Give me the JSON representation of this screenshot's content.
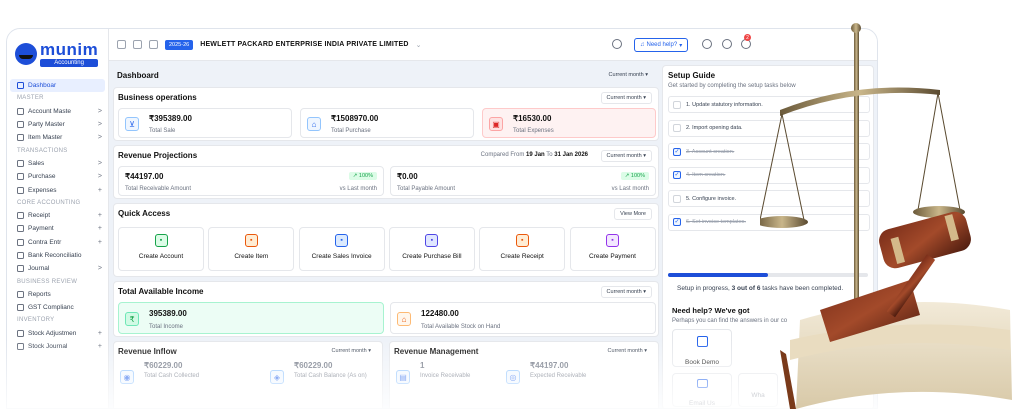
{
  "app": {
    "brand": "munim",
    "brand_sub": "Accounting",
    "fy": "2025-26",
    "company": "HEWLETT PACKARD ENTERPRISE INDIA PRIVATE LIMITED",
    "help": "Need help?",
    "notif_count": "2"
  },
  "sidebar": {
    "items": [
      {
        "type": "item",
        "label": "Dashboar",
        "active": true,
        "icon": "home-icon"
      },
      {
        "type": "sec",
        "label": "MASTER"
      },
      {
        "type": "item",
        "label": "Account Maste",
        "ar": ">",
        "icon": "bank-icon"
      },
      {
        "type": "item",
        "label": "Party Master",
        "ar": ">",
        "icon": "user-icon"
      },
      {
        "type": "item",
        "label": "Item Master",
        "ar": ">",
        "icon": "box-icon"
      },
      {
        "type": "sec",
        "label": "TRANSACTIONS"
      },
      {
        "type": "item",
        "label": "Sales",
        "ar": ">",
        "icon": "cart-icon"
      },
      {
        "type": "item",
        "label": "Purchase",
        "ar": ">",
        "icon": "bag-icon"
      },
      {
        "type": "item",
        "label": "Expenses",
        "ar": "+",
        "icon": "expense-icon"
      },
      {
        "type": "sec",
        "label": "CORE ACCOUNTING"
      },
      {
        "type": "item",
        "label": "Receipt",
        "ar": "+",
        "icon": "receipt-icon"
      },
      {
        "type": "item",
        "label": "Payment",
        "ar": "+",
        "icon": "payment-icon"
      },
      {
        "type": "item",
        "label": "Contra Entr",
        "ar": "+",
        "icon": "contra-icon"
      },
      {
        "type": "item",
        "label": "Bank Reconciliatio",
        "ar": "",
        "icon": "bank-rec-icon"
      },
      {
        "type": "item",
        "label": "Journal",
        "ar": ">",
        "icon": "journal-icon"
      },
      {
        "type": "sec",
        "label": "BUSINESS REVIEW"
      },
      {
        "type": "item",
        "label": "Reports",
        "ar": "",
        "icon": "report-icon"
      },
      {
        "type": "item",
        "label": "GST Complianc",
        "ar": "",
        "icon": "gst-icon"
      },
      {
        "type": "sec",
        "label": "INVENTORY"
      },
      {
        "type": "item",
        "label": "Stock Adjustmen",
        "ar": "+",
        "icon": "stock-icon"
      },
      {
        "type": "item",
        "label": "Stock Journal",
        "ar": "+",
        "icon": "stock-journal-icon"
      }
    ]
  },
  "dashboard": {
    "title": "Dashboard",
    "period": "Current month"
  },
  "business_ops": {
    "title": "Business operations",
    "period": "Current month",
    "cards": [
      {
        "value": "₹395389.00",
        "label": "Total Sale",
        "color": "#2563eb"
      },
      {
        "value": "₹1508970.00",
        "label": "Total Purchase",
        "color": "#2563eb"
      },
      {
        "value": "₹16530.00",
        "label": "Total Expenses",
        "color": "#dc2626"
      }
    ]
  },
  "revenue_proj": {
    "title": "Revenue Projections",
    "compared_prefix": "Compared From",
    "from": "19 Jan",
    "to_word": "To",
    "to": "31 Jan 2026",
    "period": "Current month",
    "cards": [
      {
        "value": "₹44197.00",
        "label": "Total Receivable Amount",
        "change": "100%",
        "vs": "vs Last month"
      },
      {
        "value": "₹0.00",
        "label": "Total Payable Amount",
        "change": "100%",
        "vs": "vs Last month"
      }
    ]
  },
  "quick_access": {
    "title": "Quick Access",
    "view_more": "View More",
    "items": [
      {
        "label": "Create Account",
        "color": "#16a34a",
        "bg": "#dcfce7",
        "icon": "account-icon"
      },
      {
        "label": "Create Item",
        "color": "#ea580c",
        "bg": "#ffedd5",
        "icon": "item-icon"
      },
      {
        "label": "Create Sales Invoice",
        "color": "#2563eb",
        "bg": "#dbeafe",
        "icon": "invoice-icon"
      },
      {
        "label": "Create Purchase Bill",
        "color": "#4f46e5",
        "bg": "#e0e7ff",
        "icon": "bill-icon"
      },
      {
        "label": "Create Receipt",
        "color": "#ea580c",
        "bg": "#ffedd5",
        "icon": "receipt-icon"
      },
      {
        "label": "Create Payment",
        "color": "#9333ea",
        "bg": "#f3e8ff",
        "icon": "payment-icon"
      }
    ]
  },
  "income": {
    "title": "Total Available Income",
    "period": "Current month",
    "cards": [
      {
        "value": "395389.00",
        "label": "Total Income"
      },
      {
        "value": "122480.00",
        "label": "Total Available Stock on Hand"
      }
    ]
  },
  "inflow": {
    "title": "Revenue Inflow",
    "period": "Current month",
    "cards": [
      {
        "value": "₹60229.00",
        "label": "Total Cash Collected"
      },
      {
        "value": "₹60229.00",
        "label": "Total Cash Balance (As on)"
      }
    ]
  },
  "rev_mgmt": {
    "title": "Revenue Management",
    "period": "Current month",
    "cards": [
      {
        "value": "1",
        "label": "Invoice Receivable"
      },
      {
        "value": "₹44197.00",
        "label": "Expected Receivable"
      }
    ]
  },
  "setup": {
    "title": "Setup Guide",
    "subtitle": "Get started by completing the setup tasks below",
    "tasks": [
      {
        "label": "1. Update statutory information.",
        "done": false
      },
      {
        "label": "2. Import opening data.",
        "done": false
      },
      {
        "label": "3. Account creation.",
        "done": true
      },
      {
        "label": "4. Item creation.",
        "done": true
      },
      {
        "label": "5. Configure invoice.",
        "done": false
      },
      {
        "label": "6. Set invoice templates.",
        "done": true
      }
    ],
    "progress": 0.5,
    "progress_pre": "Setup in progress,",
    "progress_bold": "3 out of 6",
    "progress_post": "tasks have been completed.",
    "help_title": "Need help? We've got",
    "help_sub": "Perhaps you can find the answers in our co",
    "book_demo": "Book Demo",
    "email_us": "Email Us",
    "whatsapp": "Wha"
  }
}
